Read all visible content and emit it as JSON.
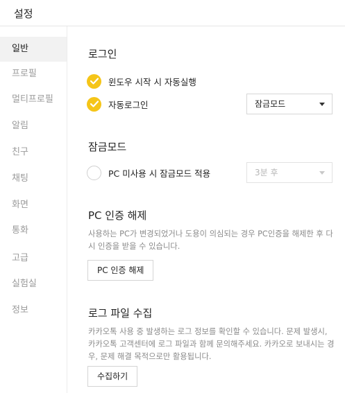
{
  "window": {
    "title": "설정"
  },
  "sidebar": {
    "items": [
      {
        "label": "일반",
        "active": true
      },
      {
        "label": "프로필"
      },
      {
        "label": "멀티프로필"
      },
      {
        "label": "알림"
      },
      {
        "label": "친구"
      },
      {
        "label": "채팅"
      },
      {
        "label": "화면"
      },
      {
        "label": "통화"
      },
      {
        "label": "고급"
      },
      {
        "label": "실험실"
      },
      {
        "label": "정보"
      }
    ]
  },
  "login": {
    "title": "로그인",
    "autostart_label": "윈도우 시작 시 자동실행",
    "autostart_checked": true,
    "autologin_label": "자동로그인",
    "autologin_checked": true,
    "autologin_mode": "잠금모드"
  },
  "lockmode": {
    "title": "잠금모드",
    "idle_lock_label": "PC 미사용 시 잠금모드 적용",
    "idle_lock_checked": false,
    "idle_time": "3분 후"
  },
  "pc_auth": {
    "title": "PC 인증 해제",
    "description": "사용하는 PC가 변경되었거나 도용이 의심되는 경우 PC인증을 해제한 후 다시 인증을 받을 수 있습니다.",
    "button": "PC 인증 해제"
  },
  "log": {
    "title": "로그 파일 수집",
    "description": "카카오톡 사용 중 발생하는 로그 정보를 확인할 수 있습니다. 문제 발생시, 카카오톡 고객센터에 로그 파일과 함께 문의해주세요. 카카오로 보내시는 경우, 문제 해결 목적으로만 활용됩니다.",
    "button": "수집하기"
  },
  "colors": {
    "accent": "#f5c518"
  }
}
